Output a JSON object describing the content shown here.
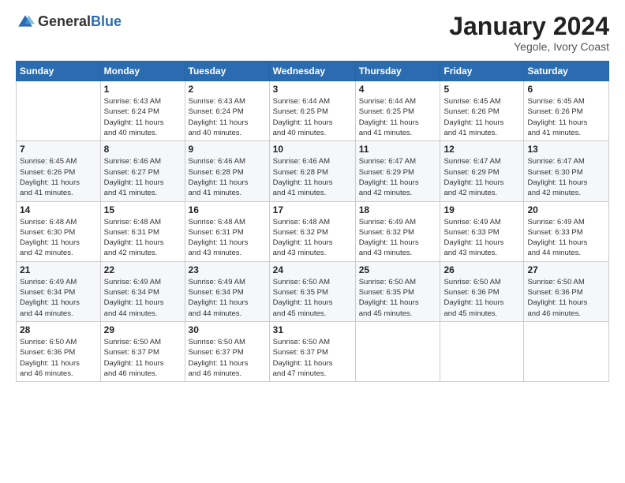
{
  "logo": {
    "general": "General",
    "blue": "Blue"
  },
  "title": "January 2024",
  "subtitle": "Yegole, Ivory Coast",
  "days_header": [
    "Sunday",
    "Monday",
    "Tuesday",
    "Wednesday",
    "Thursday",
    "Friday",
    "Saturday"
  ],
  "weeks": [
    [
      {
        "day": "",
        "detail": ""
      },
      {
        "day": "1",
        "detail": "Sunrise: 6:43 AM\nSunset: 6:24 PM\nDaylight: 11 hours\nand 40 minutes."
      },
      {
        "day": "2",
        "detail": "Sunrise: 6:43 AM\nSunset: 6:24 PM\nDaylight: 11 hours\nand 40 minutes."
      },
      {
        "day": "3",
        "detail": "Sunrise: 6:44 AM\nSunset: 6:25 PM\nDaylight: 11 hours\nand 40 minutes."
      },
      {
        "day": "4",
        "detail": "Sunrise: 6:44 AM\nSunset: 6:25 PM\nDaylight: 11 hours\nand 41 minutes."
      },
      {
        "day": "5",
        "detail": "Sunrise: 6:45 AM\nSunset: 6:26 PM\nDaylight: 11 hours\nand 41 minutes."
      },
      {
        "day": "6",
        "detail": "Sunrise: 6:45 AM\nSunset: 6:26 PM\nDaylight: 11 hours\nand 41 minutes."
      }
    ],
    [
      {
        "day": "7",
        "detail": "Sunrise: 6:45 AM\nSunset: 6:26 PM\nDaylight: 11 hours\nand 41 minutes."
      },
      {
        "day": "8",
        "detail": "Sunrise: 6:46 AM\nSunset: 6:27 PM\nDaylight: 11 hours\nand 41 minutes."
      },
      {
        "day": "9",
        "detail": "Sunrise: 6:46 AM\nSunset: 6:28 PM\nDaylight: 11 hours\nand 41 minutes."
      },
      {
        "day": "10",
        "detail": "Sunrise: 6:46 AM\nSunset: 6:28 PM\nDaylight: 11 hours\nand 41 minutes."
      },
      {
        "day": "11",
        "detail": "Sunrise: 6:47 AM\nSunset: 6:29 PM\nDaylight: 11 hours\nand 42 minutes."
      },
      {
        "day": "12",
        "detail": "Sunrise: 6:47 AM\nSunset: 6:29 PM\nDaylight: 11 hours\nand 42 minutes."
      },
      {
        "day": "13",
        "detail": "Sunrise: 6:47 AM\nSunset: 6:30 PM\nDaylight: 11 hours\nand 42 minutes."
      }
    ],
    [
      {
        "day": "14",
        "detail": "Sunrise: 6:48 AM\nSunset: 6:30 PM\nDaylight: 11 hours\nand 42 minutes."
      },
      {
        "day": "15",
        "detail": "Sunrise: 6:48 AM\nSunset: 6:31 PM\nDaylight: 11 hours\nand 42 minutes."
      },
      {
        "day": "16",
        "detail": "Sunrise: 6:48 AM\nSunset: 6:31 PM\nDaylight: 11 hours\nand 43 minutes."
      },
      {
        "day": "17",
        "detail": "Sunrise: 6:48 AM\nSunset: 6:32 PM\nDaylight: 11 hours\nand 43 minutes."
      },
      {
        "day": "18",
        "detail": "Sunrise: 6:49 AM\nSunset: 6:32 PM\nDaylight: 11 hours\nand 43 minutes."
      },
      {
        "day": "19",
        "detail": "Sunrise: 6:49 AM\nSunset: 6:33 PM\nDaylight: 11 hours\nand 43 minutes."
      },
      {
        "day": "20",
        "detail": "Sunrise: 6:49 AM\nSunset: 6:33 PM\nDaylight: 11 hours\nand 44 minutes."
      }
    ],
    [
      {
        "day": "21",
        "detail": "Sunrise: 6:49 AM\nSunset: 6:34 PM\nDaylight: 11 hours\nand 44 minutes."
      },
      {
        "day": "22",
        "detail": "Sunrise: 6:49 AM\nSunset: 6:34 PM\nDaylight: 11 hours\nand 44 minutes."
      },
      {
        "day": "23",
        "detail": "Sunrise: 6:49 AM\nSunset: 6:34 PM\nDaylight: 11 hours\nand 44 minutes."
      },
      {
        "day": "24",
        "detail": "Sunrise: 6:50 AM\nSunset: 6:35 PM\nDaylight: 11 hours\nand 45 minutes."
      },
      {
        "day": "25",
        "detail": "Sunrise: 6:50 AM\nSunset: 6:35 PM\nDaylight: 11 hours\nand 45 minutes."
      },
      {
        "day": "26",
        "detail": "Sunrise: 6:50 AM\nSunset: 6:36 PM\nDaylight: 11 hours\nand 45 minutes."
      },
      {
        "day": "27",
        "detail": "Sunrise: 6:50 AM\nSunset: 6:36 PM\nDaylight: 11 hours\nand 46 minutes."
      }
    ],
    [
      {
        "day": "28",
        "detail": "Sunrise: 6:50 AM\nSunset: 6:36 PM\nDaylight: 11 hours\nand 46 minutes."
      },
      {
        "day": "29",
        "detail": "Sunrise: 6:50 AM\nSunset: 6:37 PM\nDaylight: 11 hours\nand 46 minutes."
      },
      {
        "day": "30",
        "detail": "Sunrise: 6:50 AM\nSunset: 6:37 PM\nDaylight: 11 hours\nand 46 minutes."
      },
      {
        "day": "31",
        "detail": "Sunrise: 6:50 AM\nSunset: 6:37 PM\nDaylight: 11 hours\nand 47 minutes."
      },
      {
        "day": "",
        "detail": ""
      },
      {
        "day": "",
        "detail": ""
      },
      {
        "day": "",
        "detail": ""
      }
    ]
  ]
}
